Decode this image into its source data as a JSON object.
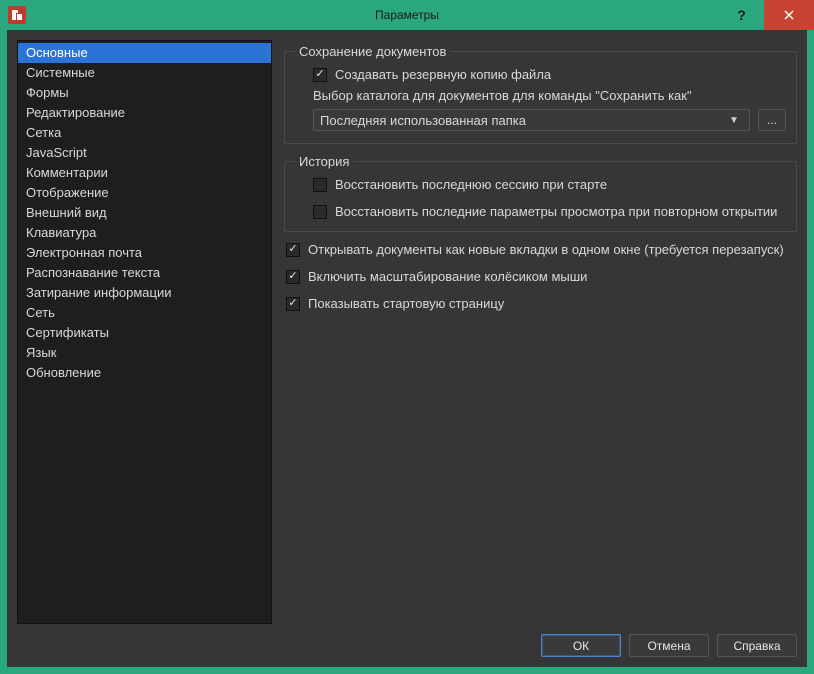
{
  "window": {
    "title": "Параметры"
  },
  "sidebar": {
    "items": [
      {
        "label": "Основные",
        "selected": true
      },
      {
        "label": "Системные",
        "selected": false
      },
      {
        "label": "Формы",
        "selected": false
      },
      {
        "label": "Редактирование",
        "selected": false
      },
      {
        "label": "Сетка",
        "selected": false
      },
      {
        "label": "JavaScript",
        "selected": false
      },
      {
        "label": "Комментарии",
        "selected": false
      },
      {
        "label": "Отображение",
        "selected": false
      },
      {
        "label": "Внешний вид",
        "selected": false
      },
      {
        "label": "Клавиатура",
        "selected": false
      },
      {
        "label": "Электронная почта",
        "selected": false
      },
      {
        "label": "Распознавание текста",
        "selected": false
      },
      {
        "label": "Затирание информации",
        "selected": false
      },
      {
        "label": "Сеть",
        "selected": false
      },
      {
        "label": "Сертификаты",
        "selected": false
      },
      {
        "label": "Язык",
        "selected": false
      },
      {
        "label": "Обновление",
        "selected": false
      }
    ]
  },
  "main": {
    "group_save": {
      "legend": "Сохранение документов",
      "backup_checkbox": {
        "label": "Создавать резервную копию файла",
        "checked": true
      },
      "folder_label": "Выбор каталога для документов для команды \"Сохранить как\"",
      "folder_select": {
        "value": "Последняя использованная папка"
      },
      "browse": "..."
    },
    "group_history": {
      "legend": "История",
      "restore_session": {
        "label": "Восстановить последнюю сессию при старте",
        "checked": false
      },
      "restore_view": {
        "label": "Восстановить последние параметры просмотра при повторном открытии",
        "checked": false
      }
    },
    "opt_tabs": {
      "label": "Открывать документы как новые вкладки в одном окне (требуется перезапуск)",
      "checked": true
    },
    "opt_wheel": {
      "label": "Включить масштабирование колёсиком мыши",
      "checked": true
    },
    "opt_start": {
      "label": "Показывать стартовую страницу",
      "checked": true
    }
  },
  "buttons": {
    "ok": "ОК",
    "cancel": "Отмена",
    "help": "Справка"
  }
}
